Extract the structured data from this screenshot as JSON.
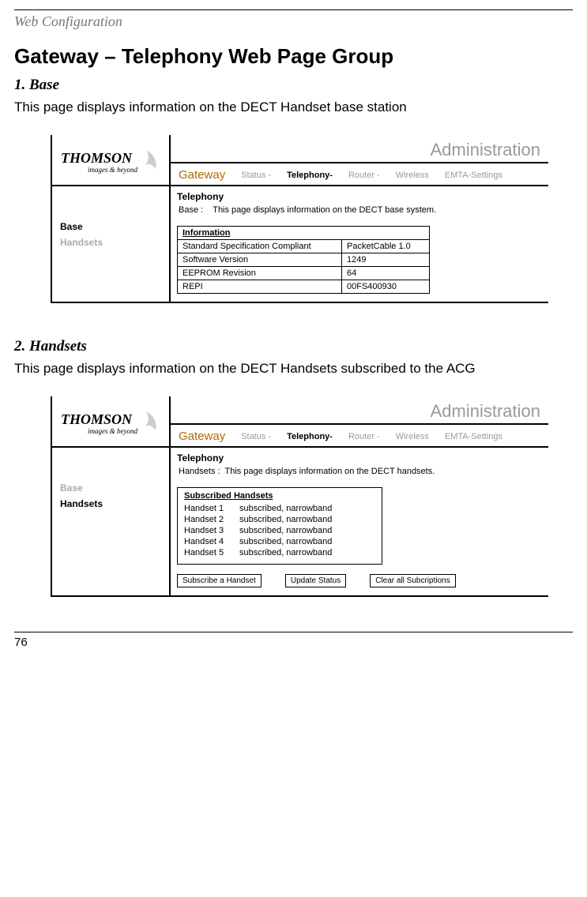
{
  "running_head": "Web Configuration",
  "title": "Gateway – Telephony Web Page Group",
  "page_number": "76",
  "section1": {
    "heading": "1. Base",
    "body": "This page displays information on the DECT Handset base station"
  },
  "section2": {
    "heading": "2. Handsets",
    "body": "This page displays information on the DECT Handsets subscribed to the ACG"
  },
  "panel_common": {
    "admin_title": "Administration",
    "brand_top": "THOMSON",
    "brand_sub": "images & beyond",
    "gateway_label": "Gateway",
    "tabs": {
      "status": "Status -",
      "telephony": "Telephony-",
      "router": "Router -",
      "wireless": "Wireless",
      "emta": "EMTA-Settings"
    },
    "section_label": "Telephony"
  },
  "panel1": {
    "side": {
      "base": "Base",
      "handsets": "Handsets"
    },
    "desc_label": "Base :",
    "desc_text": "This page displays information on the DECT base system.",
    "info": {
      "header": "Information",
      "rows": [
        {
          "k": "Standard Specification Compliant",
          "v": "PacketCable 1.0"
        },
        {
          "k": "Software Version",
          "v": "1249"
        },
        {
          "k": "EEPROM Revision",
          "v": "64"
        },
        {
          "k": "REPI",
          "v": "00FS400930"
        }
      ]
    }
  },
  "panel2": {
    "side": {
      "base": "Base",
      "handsets": "Handsets"
    },
    "desc_label": "Handsets :",
    "desc_text": "This page displays information on the DECT handsets.",
    "sub": {
      "title": "Subscribed Handsets",
      "rows": [
        {
          "name": "Handset 1",
          "status": "subscribed, narrowband"
        },
        {
          "name": "Handset 2",
          "status": "subscribed, narrowband"
        },
        {
          "name": "Handset 3",
          "status": "subscribed, narrowband"
        },
        {
          "name": "Handset 4",
          "status": "subscribed, narrowband"
        },
        {
          "name": "Handset 5",
          "status": "subscribed, narrowband"
        }
      ]
    },
    "buttons": {
      "subscribe": "Subscribe a Handset",
      "update": "Update Status",
      "clear": "Clear all Subcriptions"
    }
  }
}
